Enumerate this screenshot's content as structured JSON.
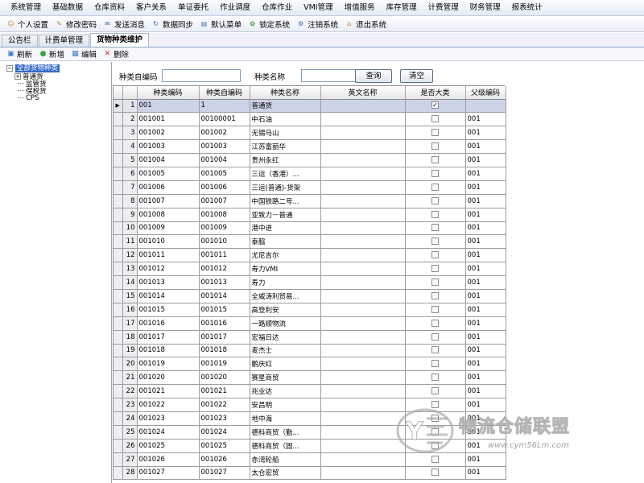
{
  "menubar": [
    "系统管理",
    "基础数据",
    "仓库资料",
    "客户关系",
    "单证委托",
    "作业调度",
    "仓库作业",
    "VMI管理",
    "增值服务",
    "库存管理",
    "计费管理",
    "财务管理",
    "报表统计"
  ],
  "toolbar": [
    {
      "label": "个人设置",
      "icon": "person-icon"
    },
    {
      "label": "修改密码",
      "icon": "key-icon"
    },
    {
      "label": "发送消息",
      "icon": "mail-icon"
    },
    {
      "label": "数据同步",
      "icon": "sync-icon"
    },
    {
      "label": "默认菜单",
      "icon": "menu-icon"
    },
    {
      "label": "锁定系统",
      "icon": "lock-icon"
    },
    {
      "label": "注销系统",
      "icon": "logout-icon"
    },
    {
      "label": "退出系统",
      "icon": "home-icon"
    }
  ],
  "tabs": [
    {
      "label": "公告栏",
      "active": false
    },
    {
      "label": "计费单管理",
      "active": false
    },
    {
      "label": "货物种类维护",
      "active": true
    }
  ],
  "subtoolbar": [
    {
      "label": "刷新",
      "icon": "refresh-icon"
    },
    {
      "label": "新增",
      "icon": "add-icon"
    },
    {
      "label": "编辑",
      "icon": "edit-icon"
    },
    {
      "label": "删除",
      "icon": "delete-icon"
    }
  ],
  "tree": {
    "root": "全部货物种类",
    "children": [
      "普通货",
      "监管货",
      "保税货",
      "CPS"
    ]
  },
  "search": {
    "category_code_label": "种类自编码",
    "category_code_value": "",
    "category_name_label": "种类名称",
    "category_name_value": "",
    "query_button": "查询",
    "clear_button": "清空"
  },
  "grid": {
    "columns": [
      "种类编码",
      "种类自编码",
      "种类名称",
      "英文名称",
      "是否大类",
      "父级编码"
    ],
    "rows": [
      {
        "n": "1",
        "code": "001",
        "self": "1",
        "name": "普通货",
        "en": "",
        "major": true,
        "parent": ""
      },
      {
        "n": "2",
        "code": "001001",
        "self": "00100001",
        "name": "中石油",
        "en": "",
        "major": false,
        "parent": "001"
      },
      {
        "n": "3",
        "code": "001002",
        "self": "001002",
        "name": "无锡马山",
        "en": "",
        "major": false,
        "parent": "001"
      },
      {
        "n": "4",
        "code": "001003",
        "self": "001003",
        "name": "江苏富丽华",
        "en": "",
        "major": false,
        "parent": "001"
      },
      {
        "n": "5",
        "code": "001004",
        "self": "001004",
        "name": "贵州永红",
        "en": "",
        "major": false,
        "parent": "001"
      },
      {
        "n": "6",
        "code": "001005",
        "self": "001005",
        "name": "三运（香港）...",
        "en": "",
        "major": false,
        "parent": "001"
      },
      {
        "n": "7",
        "code": "001006",
        "self": "001006",
        "name": "三运(普通)-货架",
        "en": "",
        "major": false,
        "parent": "001"
      },
      {
        "n": "8",
        "code": "001007",
        "self": "001007",
        "name": "中国铁路二号...",
        "en": "",
        "major": false,
        "parent": "001"
      },
      {
        "n": "9",
        "code": "001008",
        "self": "001008",
        "name": "亚致力－普通",
        "en": "",
        "major": false,
        "parent": "001"
      },
      {
        "n": "10",
        "code": "001009",
        "self": "001009",
        "name": "港中进",
        "en": "",
        "major": false,
        "parent": "001"
      },
      {
        "n": "11",
        "code": "001010",
        "self": "001010",
        "name": "泰脇",
        "en": "",
        "major": false,
        "parent": "001"
      },
      {
        "n": "12",
        "code": "001011",
        "self": "001011",
        "name": "尤尼吉尔",
        "en": "",
        "major": false,
        "parent": "001"
      },
      {
        "n": "13",
        "code": "001012",
        "self": "001012",
        "name": "寿力VMI",
        "en": "",
        "major": false,
        "parent": "001"
      },
      {
        "n": "14",
        "code": "001013",
        "self": "001013",
        "name": "寿力",
        "en": "",
        "major": false,
        "parent": "001"
      },
      {
        "n": "15",
        "code": "001014",
        "self": "001014",
        "name": "全威涛利贸易...",
        "en": "",
        "major": false,
        "parent": "001"
      },
      {
        "n": "16",
        "code": "001015",
        "self": "001015",
        "name": "高登利安",
        "en": "",
        "major": false,
        "parent": "001"
      },
      {
        "n": "17",
        "code": "001016",
        "self": "001016",
        "name": "一路顺物流",
        "en": "",
        "major": false,
        "parent": "001"
      },
      {
        "n": "18",
        "code": "001017",
        "self": "001017",
        "name": "宏福日达",
        "en": "",
        "major": false,
        "parent": "001"
      },
      {
        "n": "19",
        "code": "001018",
        "self": "001018",
        "name": "麦杰士",
        "en": "",
        "major": false,
        "parent": "001"
      },
      {
        "n": "20",
        "code": "001019",
        "self": "001019",
        "name": "鹏庆红",
        "en": "",
        "major": false,
        "parent": "001"
      },
      {
        "n": "21",
        "code": "001020",
        "self": "001020",
        "name": "赛星商贸",
        "en": "",
        "major": false,
        "parent": "001"
      },
      {
        "n": "22",
        "code": "001021",
        "self": "001021",
        "name": "兆业达",
        "en": "",
        "major": false,
        "parent": "001"
      },
      {
        "n": "23",
        "code": "001022",
        "self": "001022",
        "name": "安昌明",
        "en": "",
        "major": false,
        "parent": "001"
      },
      {
        "n": "24",
        "code": "001023",
        "self": "001023",
        "name": "地中海",
        "en": "",
        "major": false,
        "parent": "001"
      },
      {
        "n": "25",
        "code": "001024",
        "self": "001024",
        "name": "德科商贸（勤...",
        "en": "",
        "major": false,
        "parent": "001"
      },
      {
        "n": "26",
        "code": "001025",
        "self": "001025",
        "name": "德科商贸（固...",
        "en": "",
        "major": false,
        "parent": "001"
      },
      {
        "n": "27",
        "code": "001026",
        "self": "001026",
        "name": "赤湾轮船",
        "en": "",
        "major": false,
        "parent": "001"
      },
      {
        "n": "28",
        "code": "001027",
        "self": "001027",
        "name": "太仓宏贸",
        "en": "",
        "major": false,
        "parent": "001"
      }
    ]
  },
  "watermark": {
    "text": "物流仓储联盟",
    "url": "www.cym56Lm.com"
  },
  "colors": {
    "selected_row": "#cdd3e6",
    "tree_selection": "#3168c6"
  }
}
